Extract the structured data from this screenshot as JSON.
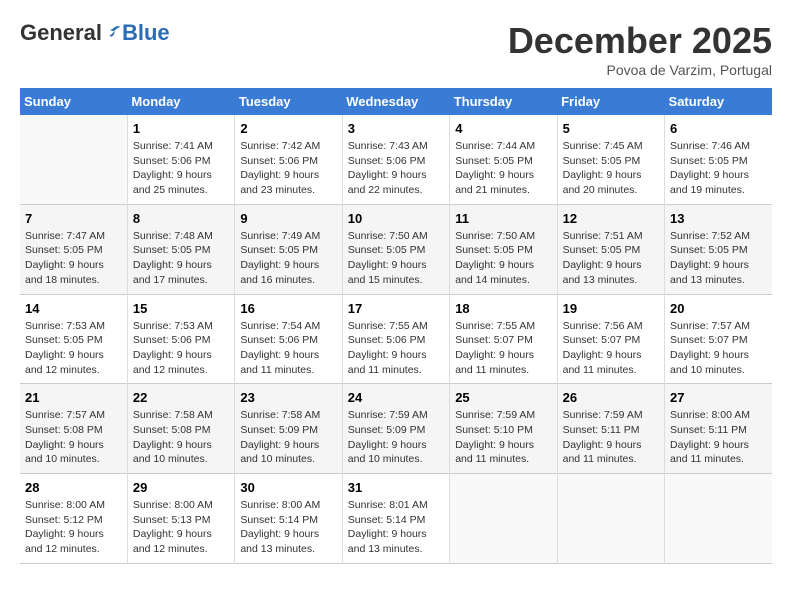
{
  "logo": {
    "general": "General",
    "blue": "Blue"
  },
  "header": {
    "month": "December 2025",
    "location": "Povoa de Varzim, Portugal"
  },
  "weekdays": [
    "Sunday",
    "Monday",
    "Tuesday",
    "Wednesday",
    "Thursday",
    "Friday",
    "Saturday"
  ],
  "weeks": [
    [
      {
        "day": "",
        "info": ""
      },
      {
        "day": "1",
        "info": "Sunrise: 7:41 AM\nSunset: 5:06 PM\nDaylight: 9 hours\nand 25 minutes."
      },
      {
        "day": "2",
        "info": "Sunrise: 7:42 AM\nSunset: 5:06 PM\nDaylight: 9 hours\nand 23 minutes."
      },
      {
        "day": "3",
        "info": "Sunrise: 7:43 AM\nSunset: 5:06 PM\nDaylight: 9 hours\nand 22 minutes."
      },
      {
        "day": "4",
        "info": "Sunrise: 7:44 AM\nSunset: 5:05 PM\nDaylight: 9 hours\nand 21 minutes."
      },
      {
        "day": "5",
        "info": "Sunrise: 7:45 AM\nSunset: 5:05 PM\nDaylight: 9 hours\nand 20 minutes."
      },
      {
        "day": "6",
        "info": "Sunrise: 7:46 AM\nSunset: 5:05 PM\nDaylight: 9 hours\nand 19 minutes."
      }
    ],
    [
      {
        "day": "7",
        "info": "Sunrise: 7:47 AM\nSunset: 5:05 PM\nDaylight: 9 hours\nand 18 minutes."
      },
      {
        "day": "8",
        "info": "Sunrise: 7:48 AM\nSunset: 5:05 PM\nDaylight: 9 hours\nand 17 minutes."
      },
      {
        "day": "9",
        "info": "Sunrise: 7:49 AM\nSunset: 5:05 PM\nDaylight: 9 hours\nand 16 minutes."
      },
      {
        "day": "10",
        "info": "Sunrise: 7:50 AM\nSunset: 5:05 PM\nDaylight: 9 hours\nand 15 minutes."
      },
      {
        "day": "11",
        "info": "Sunrise: 7:50 AM\nSunset: 5:05 PM\nDaylight: 9 hours\nand 14 minutes."
      },
      {
        "day": "12",
        "info": "Sunrise: 7:51 AM\nSunset: 5:05 PM\nDaylight: 9 hours\nand 13 minutes."
      },
      {
        "day": "13",
        "info": "Sunrise: 7:52 AM\nSunset: 5:05 PM\nDaylight: 9 hours\nand 13 minutes."
      }
    ],
    [
      {
        "day": "14",
        "info": "Sunrise: 7:53 AM\nSunset: 5:05 PM\nDaylight: 9 hours\nand 12 minutes."
      },
      {
        "day": "15",
        "info": "Sunrise: 7:53 AM\nSunset: 5:06 PM\nDaylight: 9 hours\nand 12 minutes."
      },
      {
        "day": "16",
        "info": "Sunrise: 7:54 AM\nSunset: 5:06 PM\nDaylight: 9 hours\nand 11 minutes."
      },
      {
        "day": "17",
        "info": "Sunrise: 7:55 AM\nSunset: 5:06 PM\nDaylight: 9 hours\nand 11 minutes."
      },
      {
        "day": "18",
        "info": "Sunrise: 7:55 AM\nSunset: 5:07 PM\nDaylight: 9 hours\nand 11 minutes."
      },
      {
        "day": "19",
        "info": "Sunrise: 7:56 AM\nSunset: 5:07 PM\nDaylight: 9 hours\nand 11 minutes."
      },
      {
        "day": "20",
        "info": "Sunrise: 7:57 AM\nSunset: 5:07 PM\nDaylight: 9 hours\nand 10 minutes."
      }
    ],
    [
      {
        "day": "21",
        "info": "Sunrise: 7:57 AM\nSunset: 5:08 PM\nDaylight: 9 hours\nand 10 minutes."
      },
      {
        "day": "22",
        "info": "Sunrise: 7:58 AM\nSunset: 5:08 PM\nDaylight: 9 hours\nand 10 minutes."
      },
      {
        "day": "23",
        "info": "Sunrise: 7:58 AM\nSunset: 5:09 PM\nDaylight: 9 hours\nand 10 minutes."
      },
      {
        "day": "24",
        "info": "Sunrise: 7:59 AM\nSunset: 5:09 PM\nDaylight: 9 hours\nand 10 minutes."
      },
      {
        "day": "25",
        "info": "Sunrise: 7:59 AM\nSunset: 5:10 PM\nDaylight: 9 hours\nand 11 minutes."
      },
      {
        "day": "26",
        "info": "Sunrise: 7:59 AM\nSunset: 5:11 PM\nDaylight: 9 hours\nand 11 minutes."
      },
      {
        "day": "27",
        "info": "Sunrise: 8:00 AM\nSunset: 5:11 PM\nDaylight: 9 hours\nand 11 minutes."
      }
    ],
    [
      {
        "day": "28",
        "info": "Sunrise: 8:00 AM\nSunset: 5:12 PM\nDaylight: 9 hours\nand 12 minutes."
      },
      {
        "day": "29",
        "info": "Sunrise: 8:00 AM\nSunset: 5:13 PM\nDaylight: 9 hours\nand 12 minutes."
      },
      {
        "day": "30",
        "info": "Sunrise: 8:00 AM\nSunset: 5:14 PM\nDaylight: 9 hours\nand 13 minutes."
      },
      {
        "day": "31",
        "info": "Sunrise: 8:01 AM\nSunset: 5:14 PM\nDaylight: 9 hours\nand 13 minutes."
      },
      {
        "day": "",
        "info": ""
      },
      {
        "day": "",
        "info": ""
      },
      {
        "day": "",
        "info": ""
      }
    ]
  ]
}
